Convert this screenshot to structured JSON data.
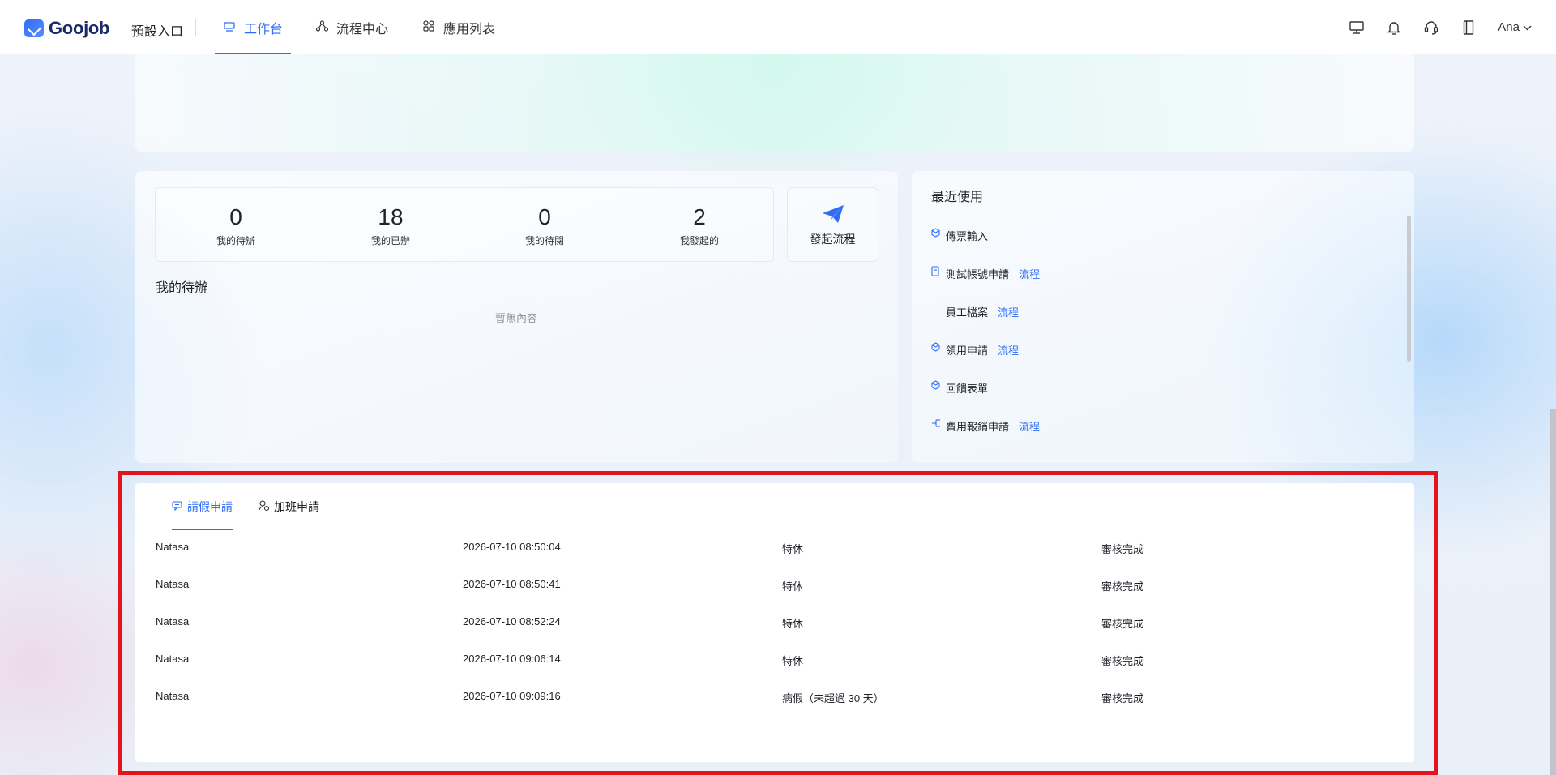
{
  "header": {
    "logo_text": "Goojob",
    "entry_label": "預設入口",
    "nav": [
      {
        "label": "工作台",
        "icon": "monitor-icon",
        "active": true
      },
      {
        "label": "流程中心",
        "icon": "flow-icon",
        "active": false
      },
      {
        "label": "應用列表",
        "icon": "grid-icon",
        "active": false
      }
    ],
    "right_icons": [
      "desktop-icon",
      "bell-icon",
      "headset-icon",
      "book-icon"
    ],
    "user_name": "Ana"
  },
  "stats": {
    "items": [
      {
        "value": "0",
        "label": "我的待辦"
      },
      {
        "value": "18",
        "label": "我的已辦"
      },
      {
        "value": "0",
        "label": "我的待閱"
      },
      {
        "value": "2",
        "label": "我發起的"
      }
    ],
    "launch_label": "發起流程",
    "todo_title": "我的待辦",
    "empty_text": "暫無內容"
  },
  "recent": {
    "title": "最近使用",
    "items": [
      {
        "label": "傳票輸入",
        "tag": "",
        "icon": "cube-icon"
      },
      {
        "label": "測試帳號申請",
        "tag": "流程",
        "icon": "form-icon"
      },
      {
        "label": "員工檔案",
        "tag": "流程",
        "icon": ""
      },
      {
        "label": "領用申請",
        "tag": "流程",
        "icon": "cube-icon"
      },
      {
        "label": "回饋表單",
        "tag": "",
        "icon": "cube-icon"
      },
      {
        "label": "費用報銷申請",
        "tag": "流程",
        "icon": "tree-icon"
      }
    ]
  },
  "table": {
    "tabs": [
      {
        "label": "請假申請",
        "icon": "chat-icon",
        "active": true
      },
      {
        "label": "加班申請",
        "icon": "user-clock-icon",
        "active": false
      }
    ],
    "rows": [
      {
        "name": "Natasa",
        "time": "2026-07-10 08:50:04",
        "type": "特休",
        "status": "審核完成"
      },
      {
        "name": "Natasa",
        "time": "2026-07-10 08:50:41",
        "type": "特休",
        "status": "審核完成"
      },
      {
        "name": "Natasa",
        "time": "2026-07-10 08:52:24",
        "type": "特休",
        "status": "審核完成"
      },
      {
        "name": "Natasa",
        "time": "2026-07-10 09:06:14",
        "type": "特休",
        "status": "審核完成"
      },
      {
        "name": "Natasa",
        "time": "2026-07-10 09:09:16",
        "type": "病假（未超過 30 天）",
        "status": "審核完成"
      }
    ]
  },
  "colors": {
    "accent": "#2f6df6",
    "highlight": "#e4141c"
  }
}
